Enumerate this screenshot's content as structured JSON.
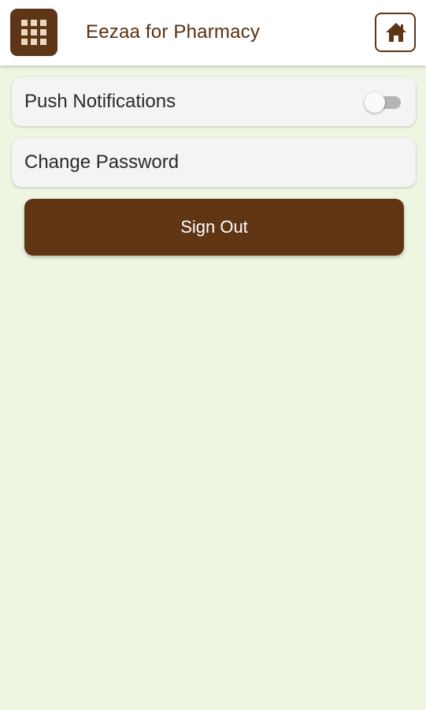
{
  "app_bar": {
    "title": "Eezaa for Pharmacy",
    "menu_icon": "grid-icon",
    "home_icon": "home-icon"
  },
  "settings": {
    "push_notifications": {
      "label": "Push Notifications",
      "enabled": false
    },
    "change_password": {
      "label": "Change Password"
    }
  },
  "actions": {
    "sign_out_label": "Sign Out"
  },
  "colors": {
    "brand": "#5e3515",
    "background": "#eef5e1",
    "card": "#f4f4f4"
  }
}
